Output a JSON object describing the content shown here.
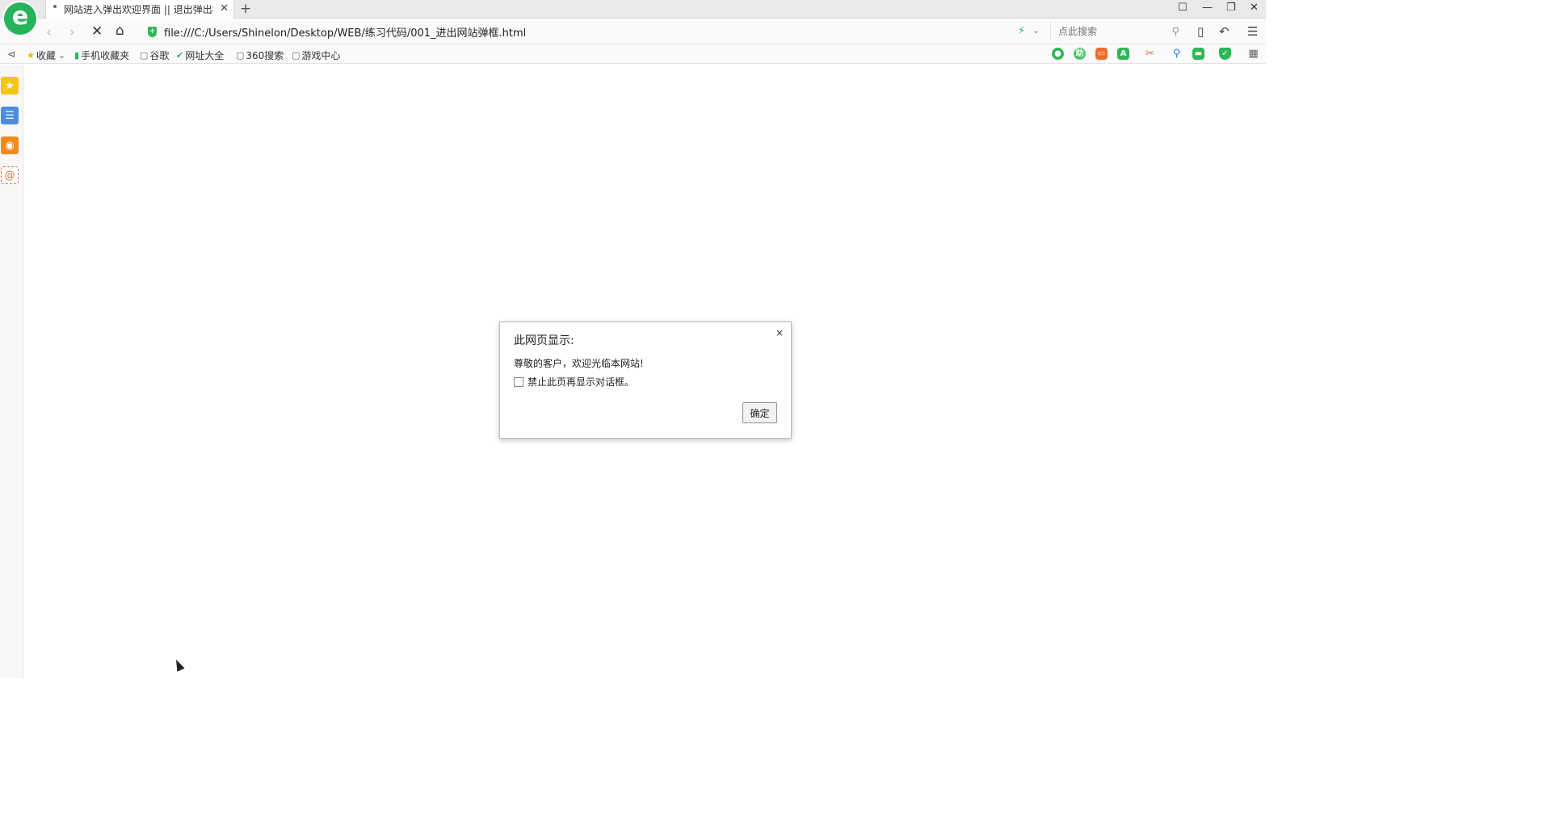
{
  "browser": {
    "logo": "e",
    "tab_title": "网站进入弹出欢迎界面 || 退出弹出框",
    "tab_close": "✕",
    "new_tab": "+",
    "url": "file:///C:/Users/Shinelon/Desktop/WEB/练习代码/001_进出网站弹框.html",
    "search_placeholder": "点此搜索",
    "window_controls": [
      "☐",
      "—",
      "❐",
      "✕"
    ]
  },
  "bookmarks": {
    "toggle": "⊲",
    "items": [
      "收藏",
      "手机收藏夹",
      "谷歌",
      "网址大全",
      "360搜索",
      "游戏中心"
    ]
  },
  "dialog": {
    "title": "此网页显示:",
    "close": "×",
    "message": "尊敬的客户，欢迎光临本网站!",
    "checkbox_label": "禁止此页再显示对话框。",
    "checkbox_checked": false,
    "ok_label": "确定"
  },
  "colors": {
    "brand_green": "#27b35b",
    "sidebar_star": "#f5c518",
    "sidebar_news": "#4a8de0",
    "sidebar_weibo": "#f08a1c",
    "sidebar_mail": "#e8663a"
  }
}
